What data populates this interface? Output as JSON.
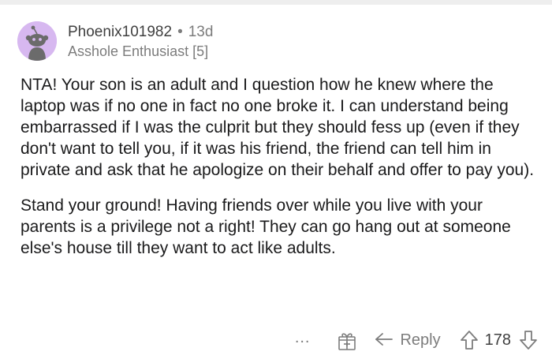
{
  "comment": {
    "author": "Phoenix101982",
    "separator": "•",
    "age": "13d",
    "flair": "Asshole Enthusiast [5]",
    "paragraphs": [
      "NTA! Your son is an adult and I question how he knew where the laptop was if no one in fact no one broke it. I can understand being embarrassed if I was the culprit but they should fess up (even if they don't want to tell you, if it was his friend, the friend can tell him in private and ask that he apologize on their behalf and offer to pay you).",
      "Stand your ground! Having friends over while you live with your parents is a privilege not a right! They can go hang out at someone else's house till they want to act like adults."
    ]
  },
  "actions": {
    "more": "...",
    "gift_icon": "gift-icon",
    "reply_icon": "reply-arrow-icon",
    "reply_label": "Reply",
    "upvote_icon": "upvote-arrow-icon",
    "score": "178",
    "downvote_icon": "downvote-arrow-icon"
  },
  "colors": {
    "avatar_bg": "#d7b8f0",
    "muted_text": "#7c7c7c",
    "body_text": "#1a1a1b"
  }
}
